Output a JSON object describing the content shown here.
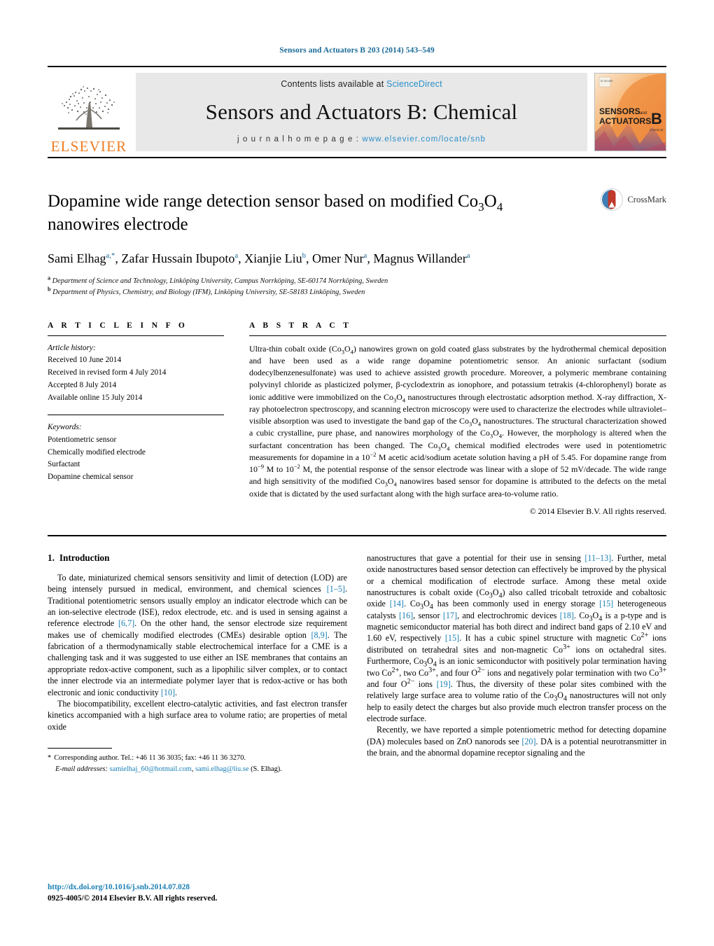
{
  "running_head": "Sensors and Actuators B 203 (2014) 543–549",
  "masthead": {
    "publisher": "ELSEVIER",
    "contents_prefix": "Contents lists available at ",
    "contents_link": "ScienceDirect",
    "journal_title": "Sensors and Actuators B: Chemical",
    "homepage_label": "j o u r n a l   h o m e p a g e :  ",
    "homepage_url": "www.elsevier.com/locate/snb",
    "cover_line1": "SENSORS",
    "cover_and": "and",
    "cover_line2": "ACTUATORS",
    "cover_letter": "B",
    "cover_sub": "Chemical"
  },
  "article": {
    "title_part1": "Dopamine wide range detection sensor based on modified Co",
    "title_sub1": "3",
    "title_mid": "O",
    "title_sub2": "4",
    "title_part2": "nanowires electrode",
    "crossmark_label": "CrossMark",
    "authors": "Sami Elhag a,*, Zafar Hussain Ibupoto a, Xianjie Liu b, Omer Nur a, Magnus Willander a",
    "affiliation_a": "Department of Science and Technology, Linköping University, Campus Norrköping, SE-60174 Norrköping, Sweden",
    "affiliation_b": "Department of Physics, Chemistry, and Biology (IFM), Linköping University, SE-58183 Linköping, Sweden"
  },
  "article_info": {
    "label": "A R T I C L E   I N F O",
    "history_header": "Article history:",
    "history": [
      "Received 10 June 2014",
      "Received in revised form 4 July 2014",
      "Accepted 8 July 2014",
      "Available online 15 July 2014"
    ],
    "keywords_header": "Keywords:",
    "keywords": [
      "Potentiometric sensor",
      "Chemically modified electrode",
      "Surfactant",
      "Dopamine chemical sensor"
    ]
  },
  "abstract": {
    "label": "A B S T R A C T",
    "text": "Ultra-thin cobalt oxide (Co3O4) nanowires grown on gold coated glass substrates by the hydrothermal chemical deposition and have been used as a wide range dopamine potentiometric sensor. An anionic surfactant (sodium dodecylbenzenesulfonate) was used to achieve assisted growth procedure. Moreover, a polymeric membrane containing polyvinyl chloride as plasticized polymer, β-cyclodextrin as ionophore, and potassium tetrakis (4-chlorophenyl) borate as ionic additive were immobilized on the Co3O4 nanostructures through electrostatic adsorption method. X-ray diffraction, X-ray photoelectron spectroscopy, and scanning electron microscopy were used to characterize the electrodes while ultraviolet–visible absorption was used to investigate the band gap of the Co3O4 nanostructures. The structural characterization showed a cubic crystalline, pure phase, and nanowires morphology of the Co3O4. However, the morphology is altered when the surfactant concentration has been changed. The Co3O4 chemical modified electrodes were used in potentiometric measurements for dopamine in a 10−2 M acetic acid/sodium acetate solution having a pH of 5.45. For dopamine range from 10−9 M to 10−2 M, the potential response of the sensor electrode was linear with a slope of 52 mV/decade. The wide range and high sensitivity of the modified Co3O4 nanowires based sensor for dopamine is attributed to the defects on the metal oxide that is dictated by the used surfactant along with the high surface area-to-volume ratio.",
    "copyright": "© 2014 Elsevier B.V. All rights reserved."
  },
  "introduction": {
    "number": "1.",
    "heading": "Introduction",
    "left_paragraphs": [
      "To date, miniaturized chemical sensors sensitivity and limit of detection (LOD) are being intensely pursued in medical, environment, and chemical sciences [1–5]. Traditional potentiometric sensors usually employ an indicator electrode which can be an ion-selective electrode (ISE), redox electrode, etc. and is used in sensing against a reference electrode [6,7]. On the other hand, the sensor electrode size requirement makes use of chemically modified electrodes (CMEs) desirable option [8,9]. The fabrication of a thermodynamically stable electrochemical interface for a CME is a challenging task and it was suggested to use either an ISE membranes that contains an appropriate redox-active component, such as a lipophilic silver complex, or to contact the inner electrode via an intermediate polymer layer that is redox-active or has both electronic and ionic conductivity [10].",
      "The biocompatibility, excellent electro-catalytic activities, and fast electron transfer kinetics accompanied with a high surface area to volume ratio; are properties of metal oxide"
    ],
    "right_paragraphs": [
      "nanostructures that gave a potential for their use in sensing [11–13]. Further, metal oxide nanostructures based sensor detection can effectively be improved by the physical or a chemical modification of electrode surface. Among these metal oxide nanostructures is cobalt oxide (Co3O4) also called tricobalt tetroxide and cobaltosic oxide [14]. Co3O4 has been commonly used in energy storage [15] heterogeneous catalysts [16], sensor [17], and electrochromic devices [18]. Co3O4 is a p-type and is magnetic semiconductor material has both direct and indirect band gaps of 2.10 eV and 1.60 eV, respectively [15]. It has a cubic spinel structure with magnetic Co2+ ions distributed on tetrahedral sites and non-magnetic Co3+ ions on octahedral sites. Furthermore, Co3O4 is an ionic semiconductor with positively polar termination having two Co2+, two Co3+, and four O2− ions and negatively polar termination with two Co3+ and four O2− ions [19]. Thus, the diversity of these polar sites combined with the relatively large surface area to volume ratio of the Co3O4 nanostructures will not only help to easily detect the charges but also provide much electron transfer process on the electrode surface.",
      "Recently, we have reported a simple potentiometric method for detecting dopamine (DA) molecules based on ZnO nanorods see [20]. DA is a potential neurotransmitter in the brain, and the abnormal dopamine receptor signaling and the"
    ]
  },
  "footnote": {
    "star": "*",
    "corresponding": "Corresponding author. Tel.: +46 11 36 3035; fax: +46 11 36 3270.",
    "email_label": "E-mail addresses:",
    "email1": "samielhaj_60@hotmail.com",
    "email2": "sami.elhag@liu.se",
    "email_suffix": "(S. Elhag)."
  },
  "footer": {
    "doi": "http://dx.doi.org/10.1016/j.snb.2014.07.028",
    "issn": "0925-4005/© 2014 Elsevier B.V. All rights reserved."
  },
  "colors": {
    "link": "#1a7fb5",
    "elsevier_orange": "#ef7c22",
    "running_head": "#1a6b99"
  }
}
